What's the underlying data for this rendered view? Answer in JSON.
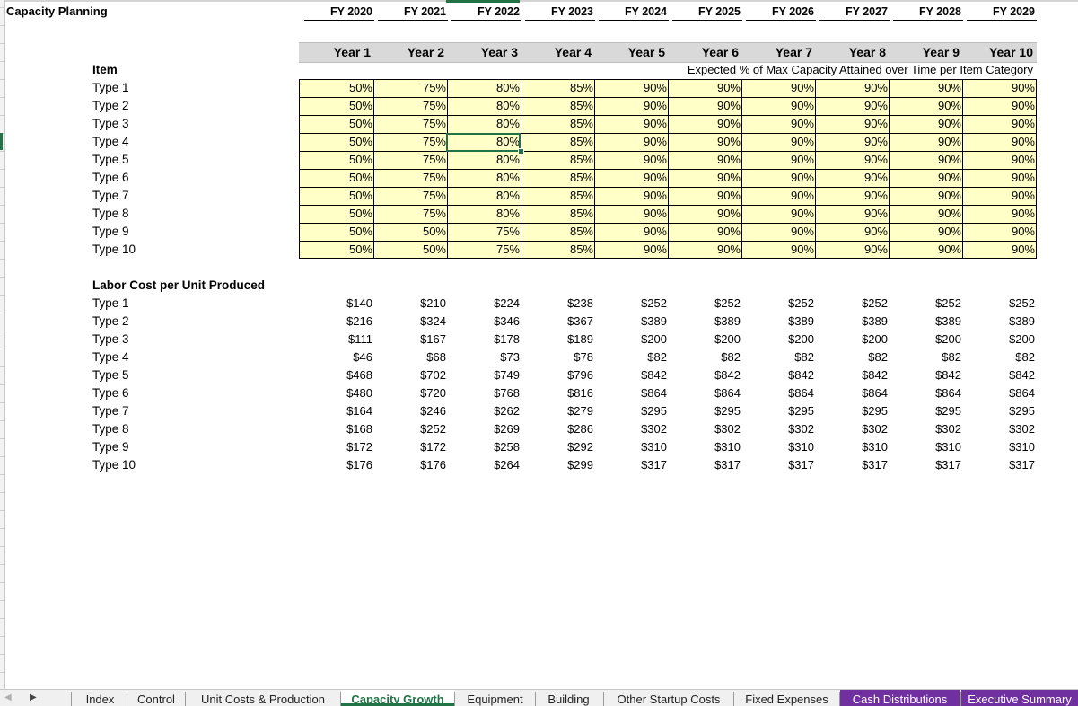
{
  "sheet": {
    "title": "Capacity Planning",
    "fiscal_years": [
      "FY 2020",
      "FY 2021",
      "FY 2022",
      "FY 2023",
      "FY 2024",
      "FY 2025",
      "FY 2026",
      "FY 2027",
      "FY 2028",
      "FY 2029"
    ],
    "years": [
      "Year 1",
      "Year 2",
      "Year 3",
      "Year 4",
      "Year 5",
      "Year 6",
      "Year 7",
      "Year 8",
      "Year 9",
      "Year 10"
    ],
    "item_header": "Item",
    "capacity_caption": "Expected % of Max Capacity Attained over Time per Item Category",
    "capacity_rows": [
      {
        "label": "Type 1",
        "values": [
          "50%",
          "75%",
          "80%",
          "85%",
          "90%",
          "90%",
          "90%",
          "90%",
          "90%",
          "90%"
        ]
      },
      {
        "label": "Type 2",
        "values": [
          "50%",
          "75%",
          "80%",
          "85%",
          "90%",
          "90%",
          "90%",
          "90%",
          "90%",
          "90%"
        ]
      },
      {
        "label": "Type 3",
        "values": [
          "50%",
          "75%",
          "80%",
          "85%",
          "90%",
          "90%",
          "90%",
          "90%",
          "90%",
          "90%"
        ]
      },
      {
        "label": "Type 4",
        "values": [
          "50%",
          "75%",
          "80%",
          "85%",
          "90%",
          "90%",
          "90%",
          "90%",
          "90%",
          "90%"
        ]
      },
      {
        "label": "Type 5",
        "values": [
          "50%",
          "75%",
          "80%",
          "85%",
          "90%",
          "90%",
          "90%",
          "90%",
          "90%",
          "90%"
        ]
      },
      {
        "label": "Type 6",
        "values": [
          "50%",
          "75%",
          "80%",
          "85%",
          "90%",
          "90%",
          "90%",
          "90%",
          "90%",
          "90%"
        ]
      },
      {
        "label": "Type 7",
        "values": [
          "50%",
          "75%",
          "80%",
          "85%",
          "90%",
          "90%",
          "90%",
          "90%",
          "90%",
          "90%"
        ]
      },
      {
        "label": "Type 8",
        "values": [
          "50%",
          "75%",
          "80%",
          "85%",
          "90%",
          "90%",
          "90%",
          "90%",
          "90%",
          "90%"
        ]
      },
      {
        "label": "Type 9",
        "values": [
          "50%",
          "50%",
          "75%",
          "85%",
          "90%",
          "90%",
          "90%",
          "90%",
          "90%",
          "90%"
        ]
      },
      {
        "label": "Type 10",
        "values": [
          "50%",
          "50%",
          "75%",
          "85%",
          "90%",
          "90%",
          "90%",
          "90%",
          "90%",
          "90%"
        ]
      }
    ],
    "labor_header": "Labor Cost per Unit Produced",
    "labor_rows": [
      {
        "label": "Type 1",
        "values": [
          "$140",
          "$210",
          "$224",
          "$238",
          "$252",
          "$252",
          "$252",
          "$252",
          "$252",
          "$252"
        ]
      },
      {
        "label": "Type 2",
        "values": [
          "$216",
          "$324",
          "$346",
          "$367",
          "$389",
          "$389",
          "$389",
          "$389",
          "$389",
          "$389"
        ]
      },
      {
        "label": "Type 3",
        "values": [
          "$111",
          "$167",
          "$178",
          "$189",
          "$200",
          "$200",
          "$200",
          "$200",
          "$200",
          "$200"
        ]
      },
      {
        "label": "Type 4",
        "values": [
          "$46",
          "$68",
          "$73",
          "$78",
          "$82",
          "$82",
          "$82",
          "$82",
          "$82",
          "$82"
        ]
      },
      {
        "label": "Type 5",
        "values": [
          "$468",
          "$702",
          "$749",
          "$796",
          "$842",
          "$842",
          "$842",
          "$842",
          "$842",
          "$842"
        ]
      },
      {
        "label": "Type 6",
        "values": [
          "$480",
          "$720",
          "$768",
          "$816",
          "$864",
          "$864",
          "$864",
          "$864",
          "$864",
          "$864"
        ]
      },
      {
        "label": "Type 7",
        "values": [
          "$164",
          "$246",
          "$262",
          "$279",
          "$295",
          "$295",
          "$295",
          "$295",
          "$295",
          "$295"
        ]
      },
      {
        "label": "Type 8",
        "values": [
          "$168",
          "$252",
          "$269",
          "$286",
          "$302",
          "$302",
          "$302",
          "$302",
          "$302",
          "$302"
        ]
      },
      {
        "label": "Type 9",
        "values": [
          "$172",
          "$172",
          "$258",
          "$292",
          "$310",
          "$310",
          "$310",
          "$310",
          "$310",
          "$310"
        ]
      },
      {
        "label": "Type 10",
        "values": [
          "$176",
          "$176",
          "$264",
          "$299",
          "$317",
          "$317",
          "$317",
          "$317",
          "$317",
          "$317"
        ]
      }
    ]
  },
  "tabs": [
    {
      "label": "Index",
      "state": "normal"
    },
    {
      "label": "Control",
      "state": "normal"
    },
    {
      "label": "Unit Costs & Production",
      "state": "normal"
    },
    {
      "label": "Capacity Growth",
      "state": "active"
    },
    {
      "label": "Equipment",
      "state": "normal"
    },
    {
      "label": "Building",
      "state": "normal"
    },
    {
      "label": "Other Startup Costs",
      "state": "normal"
    },
    {
      "label": "Fixed Expenses",
      "state": "normal"
    },
    {
      "label": "Cash Distributions",
      "state": "colored"
    },
    {
      "label": "Executive Summary",
      "state": "colored"
    }
  ],
  "colors": {
    "input_fill": "#ffffc7",
    "accent": "#217346",
    "tab_color": "#7030a0",
    "header_band": "#d9d9d9"
  },
  "icons": {
    "prev": "scroll-left-arrow-icon",
    "next": "scroll-right-arrow-icon"
  }
}
